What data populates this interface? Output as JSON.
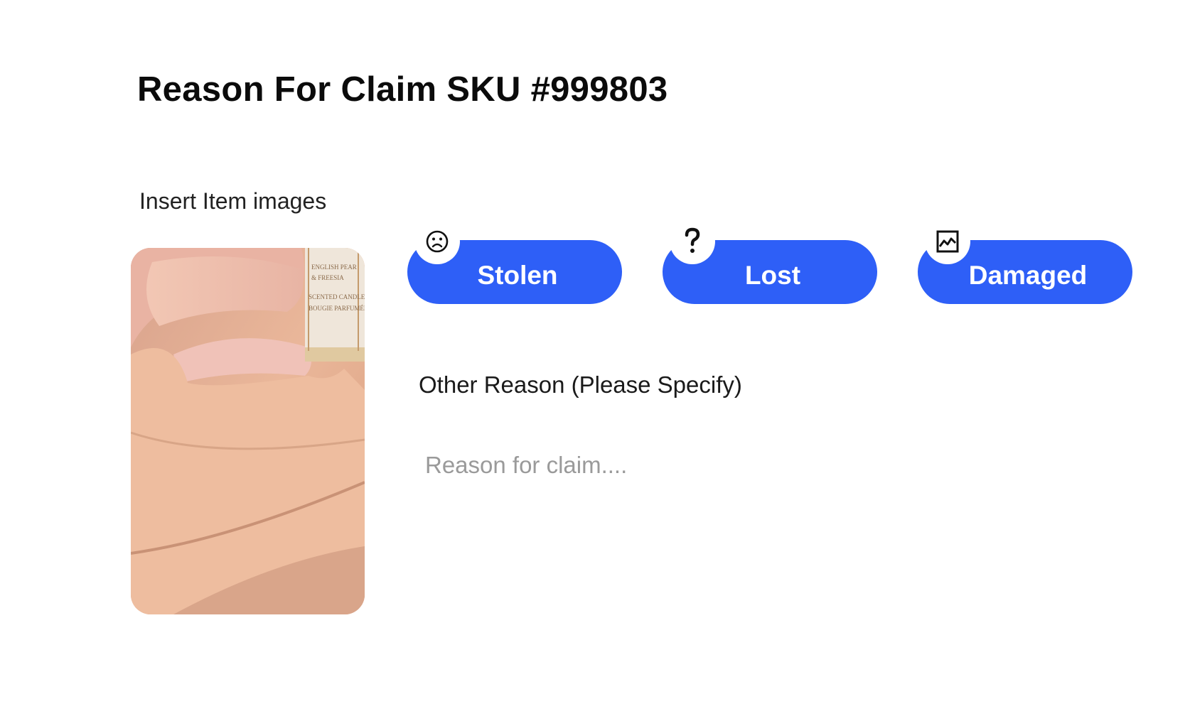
{
  "page": {
    "title": "Reason For Claim SKU #999803"
  },
  "upload": {
    "label": "Insert Item images",
    "image": {
      "description": "Photo of hand holding a scented candle",
      "label_lines": [
        "ENGLISH PEAR",
        "& FREESIA",
        "SCENTED CANDLE",
        "BOUGIE PARFUMÉE"
      ]
    }
  },
  "reasons": [
    {
      "label": "Stolen",
      "icon": "sad-face-icon"
    },
    {
      "label": "Lost",
      "icon": "question-mark-icon"
    },
    {
      "label": "Damaged",
      "icon": "broken-image-icon"
    }
  ],
  "other": {
    "label": "Other Reason (Please Specify)",
    "placeholder": "Reason for claim....",
    "value": ""
  },
  "colors": {
    "accent": "#2e5ff7",
    "text": "#0b0b0b",
    "background": "#ffffff"
  }
}
